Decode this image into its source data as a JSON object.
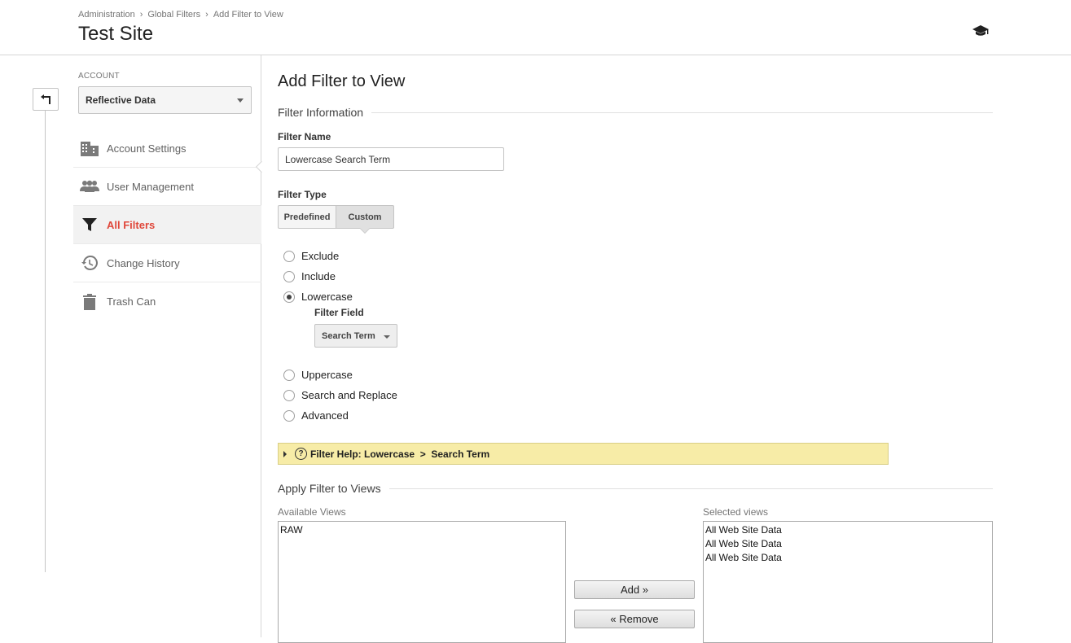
{
  "breadcrumb": [
    "Administration",
    "Global Filters",
    "Add Filter to View"
  ],
  "breadcrumb_separator": "›",
  "site_title": "Test Site",
  "header_icon": "graduation-cap-icon",
  "sidebar": {
    "account_label": "ACCOUNT",
    "account_selected": "Reflective Data",
    "items": [
      {
        "label": "Account Settings",
        "icon": "building-icon",
        "active": false
      },
      {
        "label": "User Management",
        "icon": "people-icon",
        "active": false
      },
      {
        "label": "All Filters",
        "icon": "filter-icon",
        "active": true
      },
      {
        "label": "Change History",
        "icon": "history-icon",
        "active": false
      },
      {
        "label": "Trash Can",
        "icon": "trash-icon",
        "active": false
      }
    ],
    "active_color": "#e0473a"
  },
  "main": {
    "title": "Add Filter to View",
    "filter_info_section": "Filter Information",
    "filter_name_label": "Filter Name",
    "filter_name_value": "Lowercase Search Term",
    "filter_type_label": "Filter Type",
    "filter_type_tabs": [
      "Predefined",
      "Custom"
    ],
    "filter_type_selected": "Custom",
    "options": [
      "Exclude",
      "Include",
      "Lowercase",
      "Uppercase",
      "Search and Replace",
      "Advanced"
    ],
    "selected_option": "Lowercase",
    "filter_field_label": "Filter Field",
    "filter_field_value": "Search Term",
    "help_icon": "?",
    "help_text": "Filter Help: Lowercase  >  Search Term",
    "help_bar_color": "#f7eca7",
    "apply_section": "Apply Filter to Views",
    "available_views_label": "Available Views",
    "available_views": [
      "RAW"
    ],
    "selected_views_label": "Selected views",
    "selected_views": [
      "All Web Site Data",
      "All Web Site Data",
      "All Web Site Data"
    ],
    "add_button": "Add »",
    "remove_button": "« Remove"
  }
}
